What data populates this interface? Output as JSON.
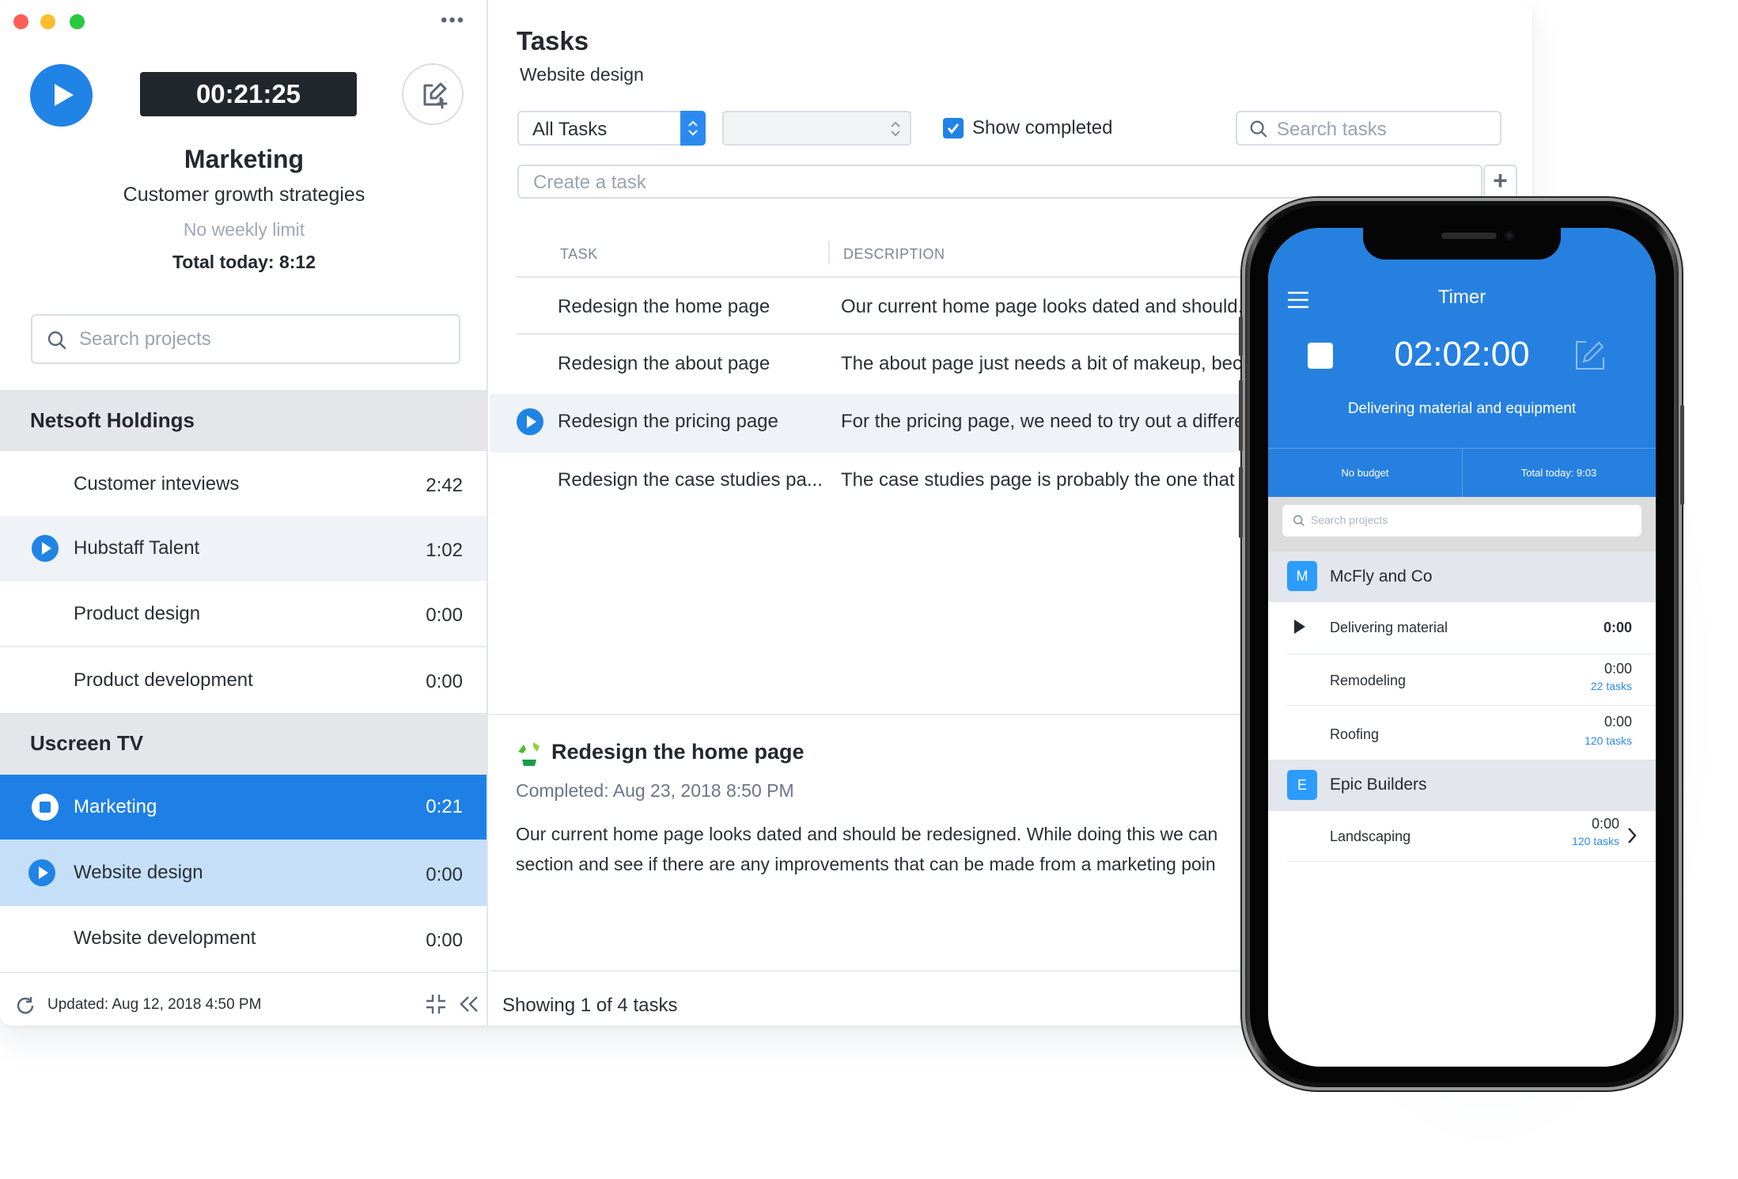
{
  "window": {
    "traffic_lights": {
      "close": "#fe5f57",
      "minimize": "#febc2e",
      "zoom": "#28c840"
    },
    "more_icon": "more-dots-icon"
  },
  "sidebar": {
    "timer": "00:21:25",
    "project_name": "Marketing",
    "client_subtitle": "Customer growth strategies",
    "weekly_limit": "No weekly limit",
    "total_today": "Total today: 8:12",
    "search_placeholder": "Search projects",
    "groups": [
      {
        "name": "Netsoft Holdings",
        "items": [
          {
            "label": "Customer inteviews",
            "time": "2:42",
            "state": "idle"
          },
          {
            "label": "Hubstaff Talent",
            "time": "1:02",
            "state": "hover"
          },
          {
            "label": "Product design",
            "time": "0:00",
            "state": "idle"
          },
          {
            "label": "Product development",
            "time": "0:00",
            "state": "idle"
          }
        ]
      },
      {
        "name": "Uscreen TV",
        "items": [
          {
            "label": "Marketing",
            "time": "0:21",
            "state": "running"
          },
          {
            "label": "Website design",
            "time": "0:00",
            "state": "selected"
          },
          {
            "label": "Website development",
            "time": "0:00",
            "state": "idle"
          }
        ]
      }
    ],
    "footer": {
      "updated": "Updated: Aug 12, 2018 4:50 PM"
    }
  },
  "main": {
    "title": "Tasks",
    "subtitle": "Website design",
    "filter_select": "All Tasks",
    "second_select": "",
    "show_completed_label": "Show completed",
    "show_completed": true,
    "search_placeholder": "Search tasks",
    "create_placeholder": "Create a task",
    "add_label": "+",
    "columns": [
      "TASK",
      "DESCRIPTION"
    ],
    "tasks": [
      {
        "task": "Redesign the home page",
        "description": "Our current home page looks dated and should..."
      },
      {
        "task": "Redesign the about page",
        "description": "The about page just needs a bit of makeup, bec..."
      },
      {
        "task": "Redesign the pricing page",
        "description": "For the pricing page, we need to try out a differe"
      },
      {
        "task": "Redesign the case studies pa...",
        "description": "The case studies page is probably the one that ..."
      }
    ],
    "detail": {
      "title": "Redesign the home page",
      "completed": "Completed: Aug 23, 2018 8:50 PM",
      "body_line1": "Our current home page looks dated and should be redesigned. While doing this we can",
      "body_line2": "section and see if there are any improvements that can be made from a marketing poin"
    },
    "footer": "Showing 1 of 4 tasks"
  },
  "phone": {
    "title": "Timer",
    "timer": "02:02:00",
    "task": "Delivering material and equipment",
    "budget": "No budget",
    "total_today": "Total today: 9:03",
    "search_placeholder": "Search projects",
    "groups": [
      {
        "initial": "M",
        "name": "McFly and Co",
        "items": [
          {
            "label": "Delivering material",
            "time": "0:00",
            "tasks": ""
          },
          {
            "label": "Remodeling",
            "time": "0:00",
            "tasks": "22 tasks"
          },
          {
            "label": "Roofing",
            "time": "0:00",
            "tasks": "120 tasks"
          }
        ]
      },
      {
        "initial": "E",
        "name": "Epic Builders",
        "items": [
          {
            "label": "Landscaping",
            "time": "0:00",
            "tasks": "120 tasks"
          }
        ]
      }
    ]
  },
  "colors": {
    "accent": "#2083e6",
    "phone_blue": "#2680e0",
    "selected_row": "#c4dff7",
    "group_bg": "#e4e6ea"
  }
}
